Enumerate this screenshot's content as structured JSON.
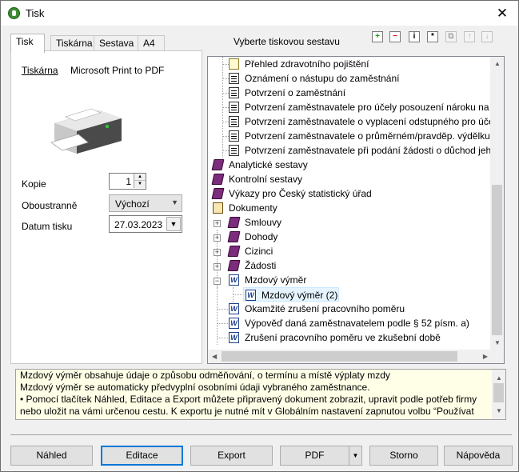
{
  "window": {
    "title": "Tisk",
    "close_glyph": "✕"
  },
  "tabs": [
    {
      "label": "Tisk"
    },
    {
      "label": "Tiskárna"
    },
    {
      "label": "Sestava"
    },
    {
      "label": "A4"
    }
  ],
  "printer": {
    "label": "Tiskárna",
    "name": "Microsoft Print to PDF"
  },
  "form": {
    "copies_label": "Kopie",
    "copies_value": "1",
    "duplex_label": "Oboustranně",
    "duplex_value": "Výchozí",
    "date_label": "Datum tisku",
    "date_value": "27.03.2023"
  },
  "report_section": {
    "title": "Vyberte tiskovou sestavu"
  },
  "toolbar": {
    "add_glyph": "+",
    "remove_glyph": "−",
    "info_glyph": "i",
    "star_glyph": "*",
    "copy_glyph": "⧉",
    "up_glyph": "↑",
    "down_glyph": "↓"
  },
  "tree": {
    "items": [
      {
        "label": "Přehled zdravotního pojištění"
      },
      {
        "label": "Oznámení o nástupu do zaměstnání"
      },
      {
        "label": "Potvrzení o zaměstnání"
      },
      {
        "label": "Potvrzení zaměstnavatele pro účely posouzení nároku na p"
      },
      {
        "label": "Potvrzení zaměstnavatele o vyplacení odstupného pro úče"
      },
      {
        "label": "Potvrzení zaměstnavatele o průměrném/pravděp. výdělku"
      },
      {
        "label": "Potvrzení zaměstnavatele při podání žádosti o důchod jeho"
      },
      {
        "label": "Analytické sestavy"
      },
      {
        "label": "Kontrolní sestavy"
      },
      {
        "label": "Výkazy pro Český statistický úřad"
      },
      {
        "label": "Dokumenty"
      },
      {
        "label": "Smlouvy"
      },
      {
        "label": "Dohody"
      },
      {
        "label": "Cizinci"
      },
      {
        "label": "Žádosti"
      },
      {
        "label": "Mzdový výměr"
      },
      {
        "label": "Mzdový výměr (2)"
      },
      {
        "label": "Okamžité zrušení pracovního poměru"
      },
      {
        "label": "Výpověď daná zaměstnavatelem podle § 52 písm. a)"
      },
      {
        "label": "Zrušení pracovního poměru ve zkušební době"
      }
    ],
    "word_glyph": "W"
  },
  "description": {
    "lines": [
      "Mzdový výměr obsahuje údaje o způsobu odměňování, o termínu a místě výplaty mzdy",
      "Mzdový výměr se automaticky předvyplní osobními údaji vybraného zaměstnance.",
      "• Pomocí tlačítek Náhled, Editace a Export můžete připravený dokument zobrazit, upravit podle potřeb firmy",
      "nebo uložit na vámi určenou cestu. K exportu je nutné mít v Globálním nastavení zapnutou volbu “Používat"
    ]
  },
  "buttons": {
    "preview": "Náhled",
    "edit": "Editace",
    "export": "Export",
    "pdf": "PDF",
    "cancel": "Storno",
    "help": "Nápověda"
  },
  "colors": {
    "accent": "#0078d7",
    "selection": "#e5f3ff",
    "note_bg": "#ffffe7"
  }
}
